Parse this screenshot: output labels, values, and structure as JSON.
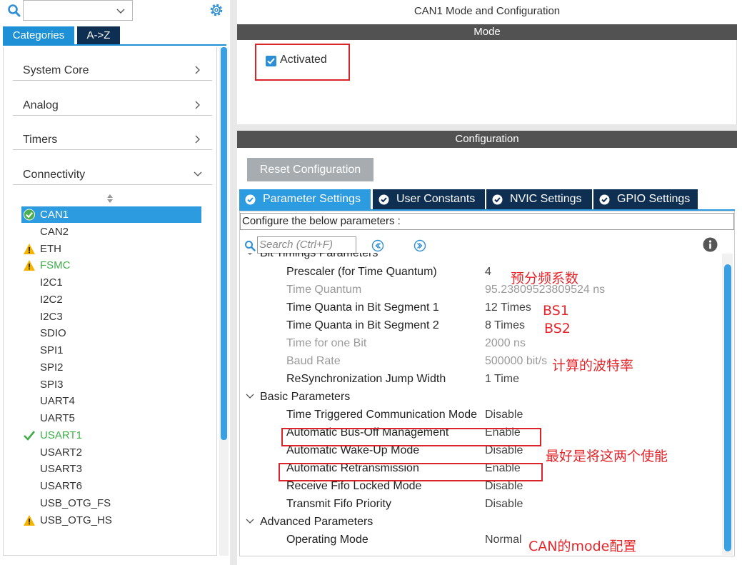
{
  "left": {
    "tabs": [
      "Categories",
      "A->Z"
    ],
    "categories": [
      "System Core",
      "Analog",
      "Timers",
      "Connectivity"
    ],
    "items": [
      {
        "label": "CAN1",
        "status": "check-selected"
      },
      {
        "label": "CAN2",
        "status": ""
      },
      {
        "label": "ETH",
        "status": "warning"
      },
      {
        "label": "FSMC",
        "status": "warning-green"
      },
      {
        "label": "I2C1",
        "status": ""
      },
      {
        "label": "I2C2",
        "status": ""
      },
      {
        "label": "I2C3",
        "status": ""
      },
      {
        "label": "SDIO",
        "status": ""
      },
      {
        "label": "SPI1",
        "status": ""
      },
      {
        "label": "SPI2",
        "status": ""
      },
      {
        "label": "SPI3",
        "status": ""
      },
      {
        "label": "UART4",
        "status": ""
      },
      {
        "label": "UART5",
        "status": ""
      },
      {
        "label": "USART1",
        "status": "check-green"
      },
      {
        "label": "USART2",
        "status": ""
      },
      {
        "label": "USART3",
        "status": ""
      },
      {
        "label": "USART6",
        "status": ""
      },
      {
        "label": "USB_OTG_FS",
        "status": ""
      },
      {
        "label": "USB_OTG_HS",
        "status": "warning"
      }
    ]
  },
  "right": {
    "title": "CAN1 Mode and Configuration",
    "mode_header": "Mode",
    "activated_label": "Activated",
    "config_header": "Configuration",
    "reset_button": "Reset Configuration",
    "tabs": [
      "Parameter Settings",
      "User Constants",
      "NVIC Settings",
      "GPIO Settings"
    ],
    "hint": "Configure the below parameters :",
    "search_placeholder": "Search (Ctrl+F)",
    "partial_group": "Bit Timings Parameters",
    "bit_timings": [
      {
        "k": "Prescaler (for Time Quantum)",
        "v": "4"
      },
      {
        "k": "Time Quantum",
        "v": "95.23809523809524 ns"
      },
      {
        "k": "Time Quanta in Bit Segment 1",
        "v": "12 Times"
      },
      {
        "k": "Time Quanta in Bit Segment 2",
        "v": "8 Times"
      },
      {
        "k": "Time for one Bit",
        "v": "2000 ns"
      },
      {
        "k": "Baud Rate",
        "v": "500000 bit/s"
      },
      {
        "k": "ReSynchronization Jump Width",
        "v": "1 Time"
      }
    ],
    "basic_group": "Basic Parameters",
    "basic": [
      {
        "k": "Time Triggered Communication Mode",
        "v": "Disable"
      },
      {
        "k": "Automatic Bus-Off Management",
        "v": "Enable"
      },
      {
        "k": "Automatic Wake-Up Mode",
        "v": "Disable"
      },
      {
        "k": "Automatic Retransmission",
        "v": "Enable"
      },
      {
        "k": "Receive Fifo Locked Mode",
        "v": "Disable"
      },
      {
        "k": "Transmit Fifo Priority",
        "v": "Disable"
      }
    ],
    "advanced_group": "Advanced Parameters",
    "advanced": [
      {
        "k": "Operating Mode",
        "v": "Normal"
      }
    ]
  },
  "annotations": {
    "prescaler": "预分频系数",
    "bs1": "BS1",
    "bs2": "BS2",
    "baud": "计算的波特率",
    "enable": "最好是将这两个使能",
    "mode": "CAN的mode配置"
  },
  "colors": {
    "accent": "#2d9be0",
    "dark_tab": "#0e2e52",
    "annotation": "#e5262b",
    "ok_green": "#3fae49",
    "warn_yellow": "#f5b400"
  }
}
